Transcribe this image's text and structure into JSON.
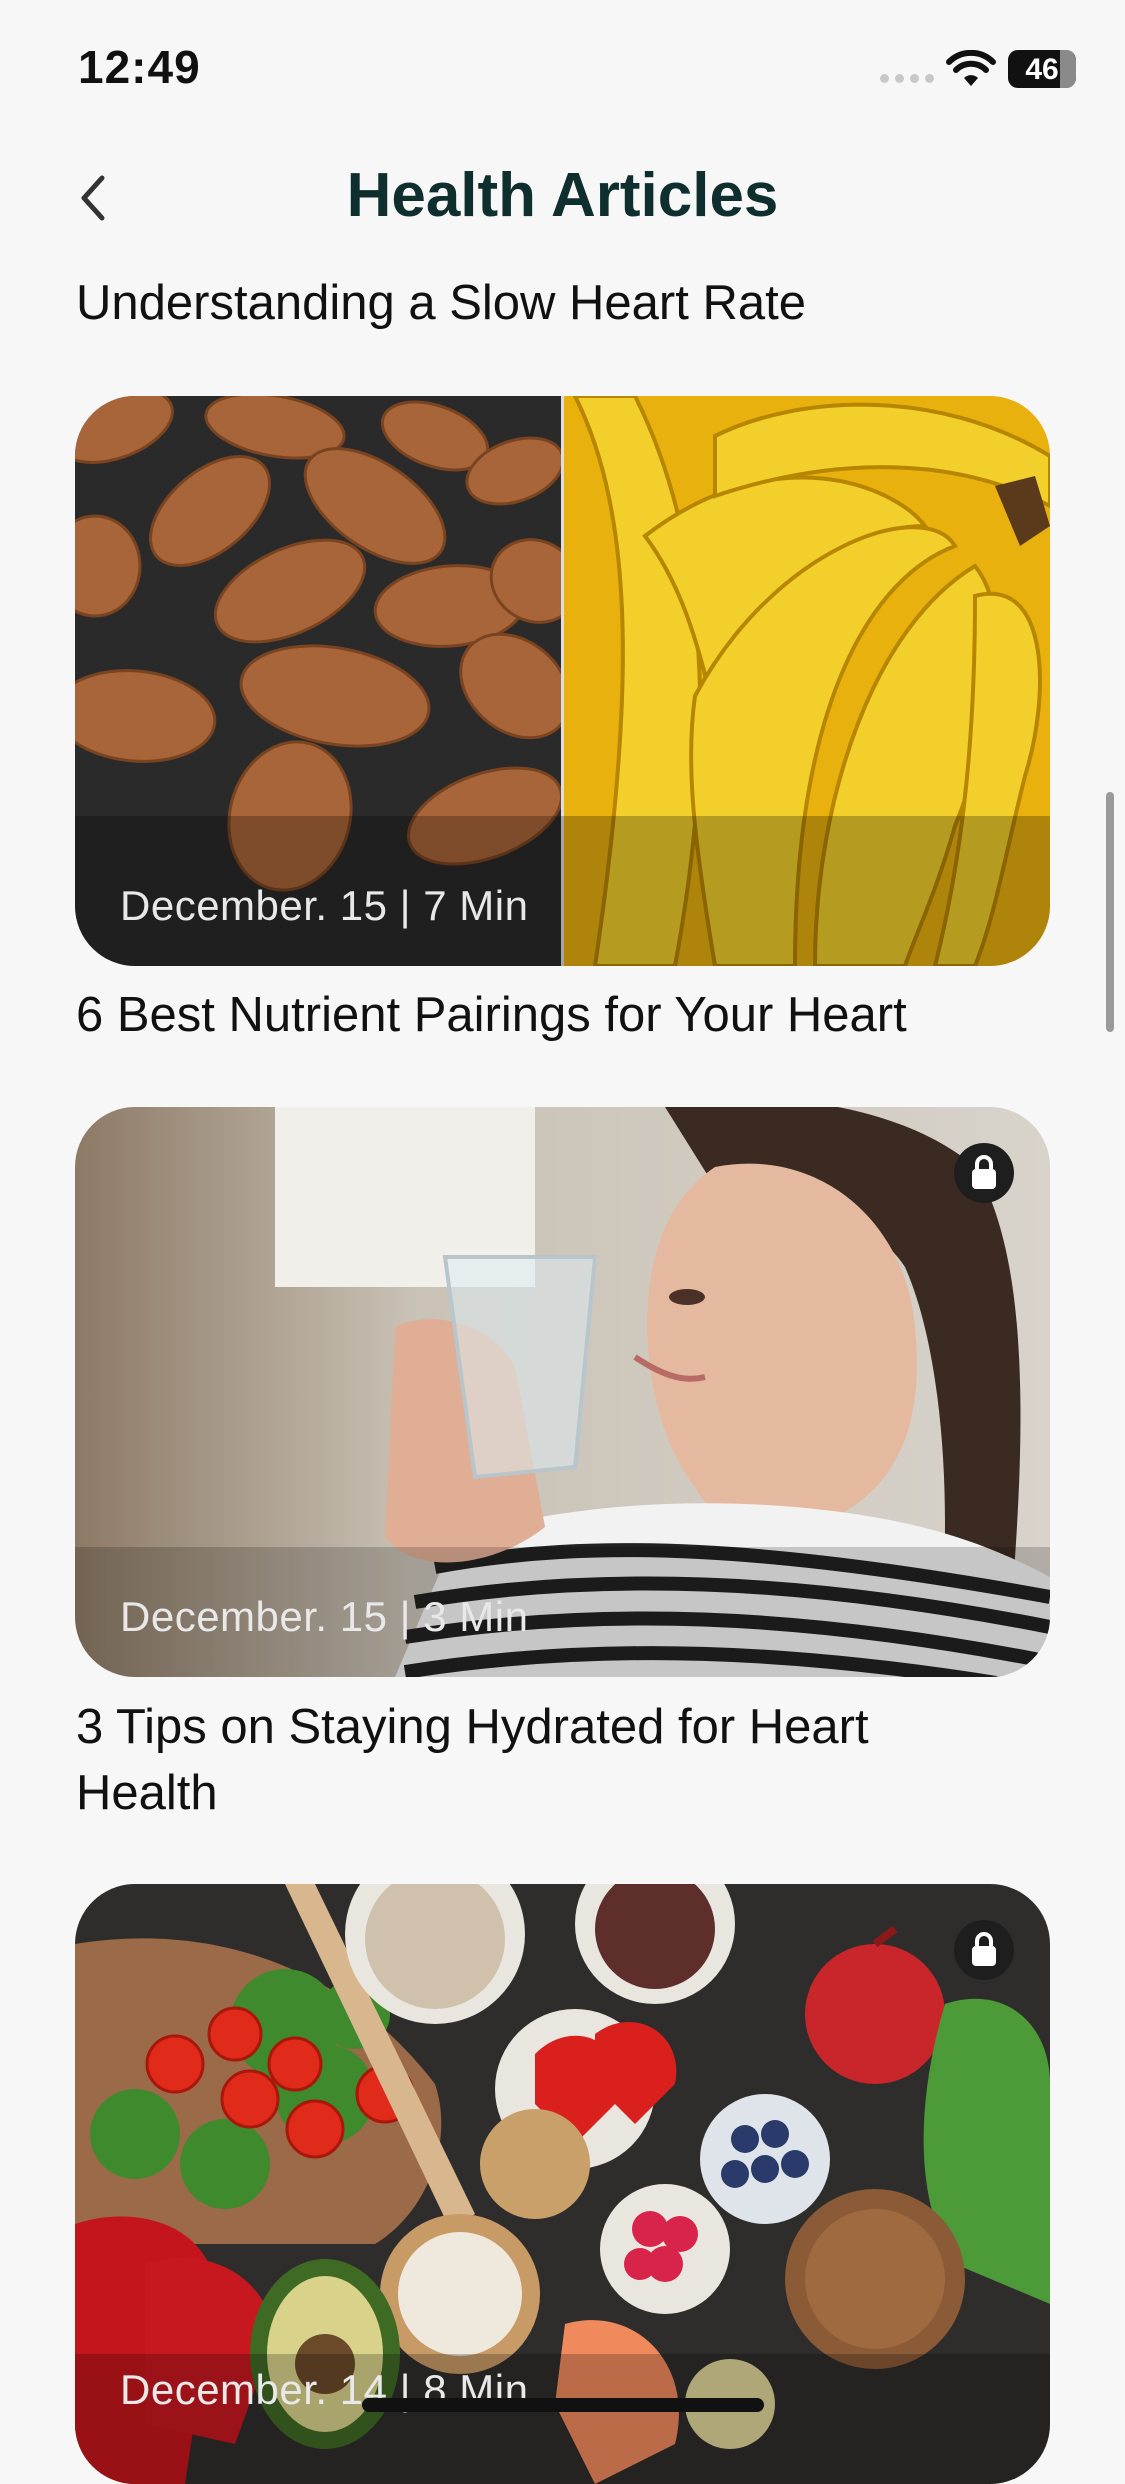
{
  "status": {
    "time": "12:49",
    "battery": "46"
  },
  "header": {
    "title": "Health Articles"
  },
  "articles": [
    {
      "title": "Understanding a Slow Heart Rate"
    },
    {
      "meta": "December. 15 | 7 Min",
      "title": "6 Best Nutrient Pairings for Your Heart",
      "image": "almonds-and-bananas",
      "locked": false
    },
    {
      "meta": "December. 15 | 3 Min",
      "title": "3 Tips on Staying Hydrated for Heart Health",
      "image": "woman-drinking-water",
      "locked": true
    },
    {
      "meta": "December. 14 | 8 Min",
      "image": "heart-healthy-foods",
      "locked": true
    }
  ],
  "icons": [
    "back-chevron-icon",
    "wifi-icon",
    "battery-icon",
    "lock-icon"
  ]
}
